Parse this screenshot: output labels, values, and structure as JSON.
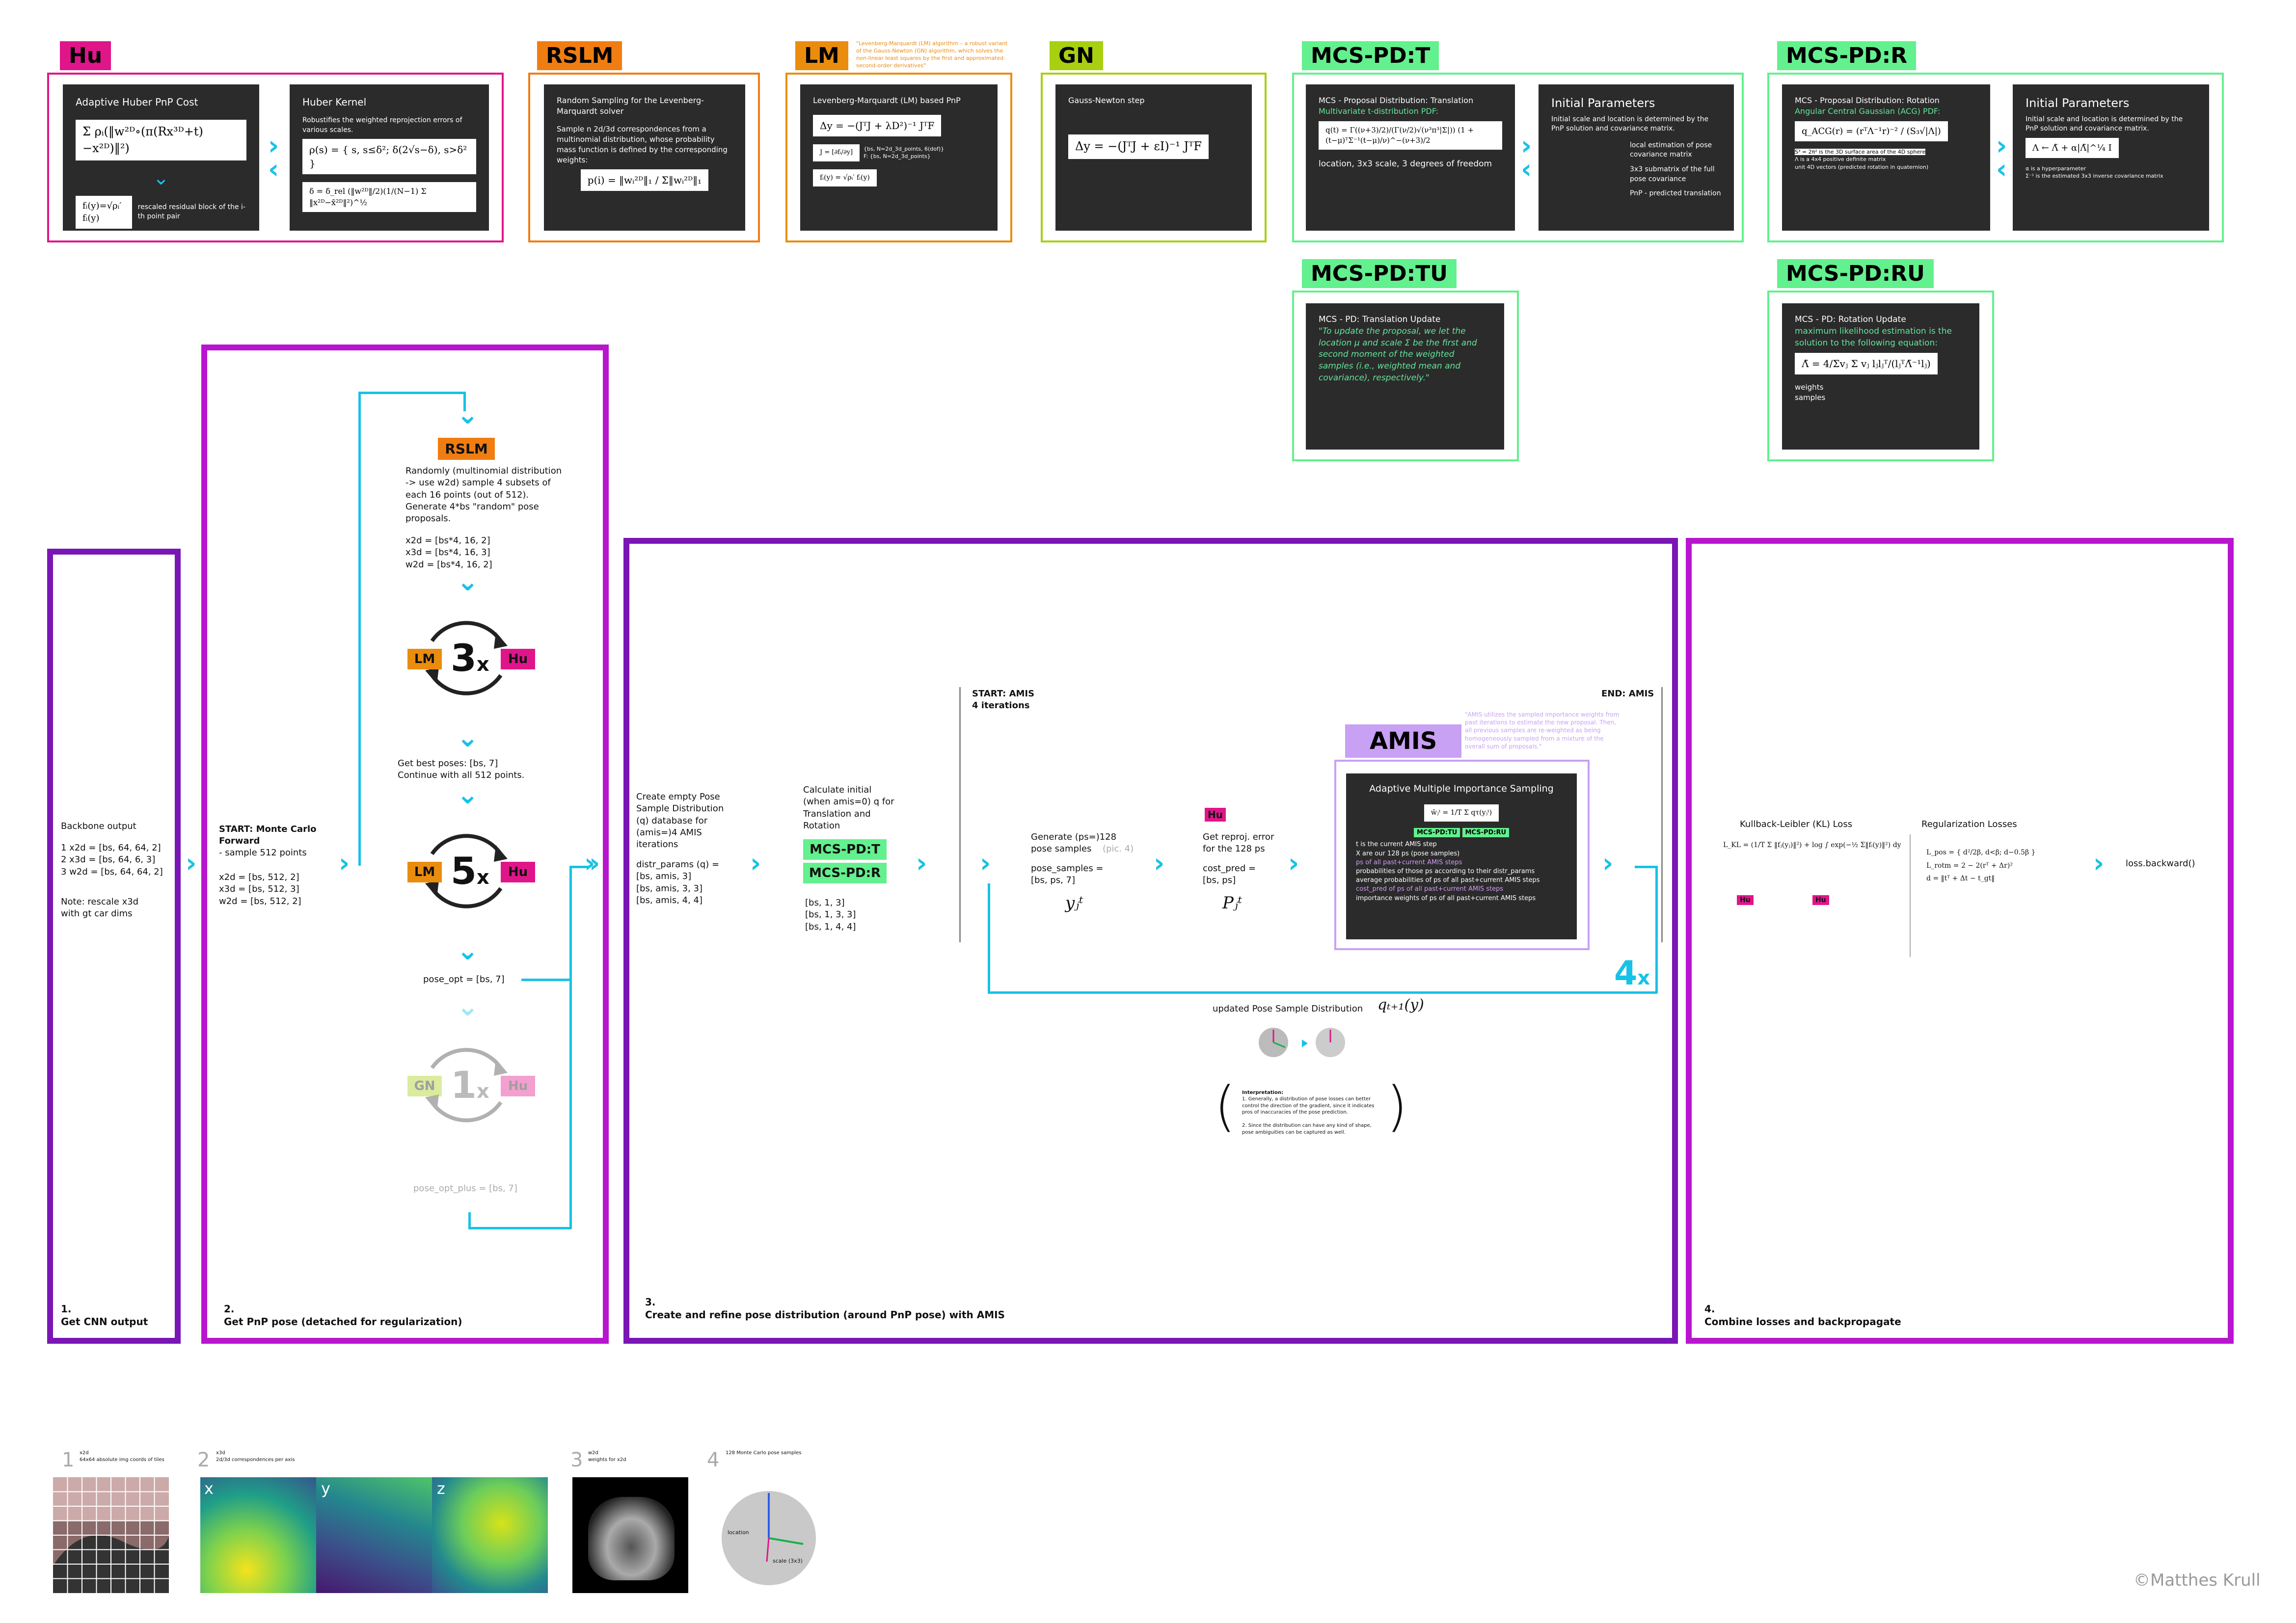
{
  "colors": {
    "magenta": "#e0158a",
    "orange": "#f07d12",
    "lm": "#ea8c0e",
    "gn": "#a8cf10",
    "green": "#63f08e",
    "purple": "#8a10b8",
    "violet": "#c20ecf",
    "cyan": "#17c2e6"
  },
  "top": {
    "hu": {
      "tag": "Hu",
      "card1_title": "Adaptive Huber PnP Cost",
      "card1_note": "rescaled residual block of the i-th point pair",
      "card2_title": "Huber Kernel",
      "card2_desc": "Robustifies the weighted reprojection errors of various scales."
    },
    "rslm": {
      "tag": "RSLM",
      "title": "Random Sampling for the Levenberg-Marquardt solver",
      "desc": "Sample n 2d/3d correspondences from a multinomial distribution, whose probability mass function is defined by the corresponding weights:"
    },
    "lm": {
      "tag": "LM",
      "note": "\"Levenberg-Marquardt (LM) algorithm – a robust variant of the Gauss-Newton (GN) algorithm, which solves the non-linear least squares by the first and approximated second-order derivatives\"",
      "title": "Levenberg-Marquardt (LM) based PnP",
      "n1": "{bs, N=2d_3d_points, 6(dof)}",
      "n2": "F: {bs, N=2d_3d_points}"
    },
    "gn": {
      "tag": "GN",
      "title": "Gauss-Newton step"
    },
    "mcspdt": {
      "tag": "MCS-PD:T",
      "title": "MCS - Proposal Distribution: Translation",
      "subtitle": "Multivariate t-distribution PDF:",
      "bottom": "location, 3x3 scale, 3 degrees of freedom",
      "p_title": "Initial Parameters",
      "p_desc": "Initial scale and location is determined by the PnP solution and covariance matrix.",
      "p1": "local estimation of pose covariance matrix",
      "p2": "3x3 submatrix of the full pose covariance",
      "p3": "PnP - predicted translation"
    },
    "mcspdr": {
      "tag": "MCS-PD:R",
      "title": "MCS - Proposal Distribution: Rotation",
      "subtitle": "Angular Central Gaussian (ACG) PDF:",
      "n1": "S³ = 2π² is the 3D surface area of the 4D sphere",
      "n2": "Λ is a 4x4 positive definite matrix",
      "n3": "unit 4D vectors (predicted rotation in quaternion)",
      "p_title": "Initial Parameters",
      "p_desc": "Initial scale and location is determined by the PnP solution and covariance matrix.",
      "p1": "α is a hyperparameter",
      "p2": "Σ⁻¹ is the estimated 3x3 inverse covariance matrix"
    },
    "mcspdtu": {
      "tag": "MCS-PD:TU",
      "title": "MCS - PD: Translation Update",
      "quote": "\"To update the proposal, we let the location μ and scale Σ be the first and second moment of the weighted samples (i.e., weighted mean and covariance), respectively.\""
    },
    "mcspdru": {
      "tag": "MCS-PD:RU",
      "title": "MCS - PD: Rotation Update",
      "desc_a": "maximum likelihood estimation",
      "desc_b": "is the solution to the following equation:",
      "w": "weights",
      "s": "samples"
    }
  },
  "stage1": {
    "heading": "Backbone output",
    "lines": "1 x2d  = [bs, 64, 64, 2]\n2 x3d = [bs, 64, 6, 3]\n3 w2d = [bs, 64, 64, 2]",
    "note": "Note: rescale x3d\nwith gt car dims",
    "label": "1.\nGet CNN output"
  },
  "stage2": {
    "start_bold": "START: Monte Carlo\nForward",
    "start": "- sample 512 points",
    "start_dims": "x2d = [bs, 512, 2]\nx3d = [bs, 512, 3]\nw2d = [bs, 512, 2]",
    "rslm": "RSLM",
    "rslm_text": "Randomly (multinomial distribution\n-> use w2d) sample 4 subsets of\neach 16 points (out of 512).\nGenerate 4*bs \"random\" pose\nproposals.",
    "rslm_dims": "x2d = [bs*4, 16, 2]\nx3d = [bs*4, 16, 3]\nw2d = [bs*4, 16, 2]",
    "lm": "LM",
    "hu": "Hu",
    "gn": "GN",
    "c3": "3",
    "c5": "5",
    "c1": "1",
    "x": "x",
    "best": "Get best poses: [bs, 7]\nContinue with all 512 points.",
    "pose_opt": "pose_opt = [bs, 7]",
    "pose_opt_plus": "pose_opt_plus = [bs, 7]",
    "label": "2.\nGet PnP pose (detached for regularization)"
  },
  "stage3": {
    "create": "Create empty Pose\nSample Distribution\n(q) database for\n(amis=)4 AMIS\niterations",
    "distr": "distr_params (q) =\n[bs, amis, 3]\n[bs, amis, 3, 3]\n[bs, amis, 4, 4]",
    "calc": "Calculate initial\n(when amis=0) q for\nTranslation and\nRotation",
    "t": "MCS-PD:T",
    "r": "MCS-PD:R",
    "calc_dims": "[bs, 1, 3]\n[bs, 1, 3, 3]\n[bs, 1, 4, 4]",
    "start": "START: AMIS\n4 iterations",
    "end": "END: AMIS",
    "gen": "Generate (ps=)128\npose samples",
    "gen_grey": "(pic. 4)",
    "gen_dims": "pose_samples =\n[bs, ps, 7]",
    "hu": "Hu",
    "reproj": "Get reproj. error\nfor the 128 ps",
    "reproj_dims": "cost_pred =\n[bs, ps]",
    "amis_tag": "AMIS",
    "amis_note": "\"AMIS utilizes the sampled importance weights from past iterations to estimate the new proposal. Then, all previous samples are re-weighted as being homogeneously sampled from a mixture of the overall sum of proposals.\"",
    "amis_title": "Adaptive Multiple Importance Sampling",
    "tu": "MCS-PD:TU",
    "ru": "MCS-PD:RU",
    "l1": "t is the current AMIS step",
    "l2": "X are our 128 ps (pose samples)",
    "l3": "ps of all past+current AMIS steps",
    "l4": "probabilities of those ps according to their distr_params",
    "l5": "average probabilities of ps of all past+current AMIS steps",
    "l6": "cost_pred of ps of all past+current AMIS steps",
    "l7": "importance weights of ps of all past+current AMIS steps",
    "four": "4",
    "updated": "updated Pose Sample Distribution",
    "interp_title": "Interpretation:",
    "interp1": "1. Generally, a distribution of pose losses can better control the direction of the gradient, since it indicates pros of inaccuracies of the pose prediction.",
    "interp2": "2. Since the distribution can have any kind of shape, pose ambiguities can be captured as well.",
    "label": "3.\nCreate and refine pose distribution (around PnP pose) with AMIS"
  },
  "stage4": {
    "kl": "Kullback-Leibler (KL) Loss",
    "reg": "Regularization Losses",
    "backward": "loss.backward()",
    "hu": "Hu",
    "label": "4.\nCombine losses and backpropagate"
  },
  "pics": {
    "p1n": "1",
    "p1t": "x2d\n64x64 absolute img coords of tiles",
    "p2n": "2",
    "p2t": "x3d\n2d/3d correspondences per axis",
    "p3n": "3",
    "p3t": "w2d\nweights for x2d",
    "p4n": "4",
    "p4t": "128 Monte Carlo pose samples",
    "x": "x",
    "y": "y",
    "z": "z",
    "loc": "location",
    "scale": "scale (3x3)"
  },
  "credit": "©Matthes Krull"
}
